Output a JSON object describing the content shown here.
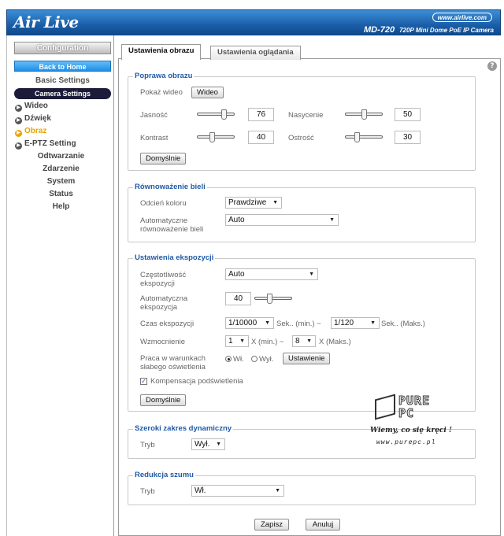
{
  "header": {
    "logo_text": "Air Live",
    "url_badge": "www.airlive.com",
    "model": "MD-720",
    "model_subtitle": "720P Mini Dome PoE IP Camera"
  },
  "sidebar": {
    "configuration": "Configuration",
    "back_home": "Back to Home",
    "basic_settings": "Basic Settings",
    "camera_settings": "Camera Settings",
    "items": [
      {
        "label": "Wideo",
        "active": false
      },
      {
        "label": "Dźwięk",
        "active": false
      },
      {
        "label": "Obraz",
        "active": true
      },
      {
        "label": "E-PTZ Setting",
        "active": false
      }
    ],
    "sub_items": [
      "Odtwarzanie",
      "Zdarzenie",
      "System",
      "Status",
      "Help"
    ]
  },
  "tabs": {
    "image_settings": "Ustawienia obrazu",
    "view_settings": "Ustawienia oglądania"
  },
  "image_improve": {
    "title": "Poprawa obrazu",
    "show_video_label": "Pokaż wideo",
    "video_button": "Wideo",
    "brightness_label": "Jasność",
    "brightness": 76,
    "saturation_label": "Nasycenie",
    "saturation": 50,
    "contrast_label": "Kontrast",
    "contrast": 40,
    "sharpness_label": "Ostrość",
    "sharpness": 30,
    "default_button": "Domyślnie"
  },
  "white_balance": {
    "title": "Równoważenie bieli",
    "color_tone_label": "Odcień koloru",
    "color_tone_value": "Prawdziwe",
    "auto_wb_label_1": "Automatyczne",
    "auto_wb_label_2": "równoważenie bieli",
    "auto_wb_value": "Auto"
  },
  "exposure": {
    "title": "Ustawienia ekspozycji",
    "freq_label_1": "Częstotliwość",
    "freq_label_2": "ekspozycji",
    "freq_value": "Auto",
    "auto_exp_label_1": "Automatyczna",
    "auto_exp_label_2": "ekspozycja",
    "auto_exp_value": 40,
    "time_label": "Czas ekspozycji",
    "time_min": "1/10000",
    "time_min_suffix": "Sek.. (min.) ~",
    "time_max": "1/120",
    "time_max_suffix": "Sek.. (Maks.)",
    "gain_label": "Wzmocnienie",
    "gain_min": "1",
    "gain_min_suffix": "X (min.) ~",
    "gain_max": "8",
    "gain_max_suffix": "X (Maks.)",
    "lowlight_label_1": "Praca w warunkach",
    "lowlight_label_2": "słabego oświetlenia",
    "lowlight_on": "Wł.",
    "lowlight_off": "Wył.",
    "lowlight_button": "Ustawienie",
    "backlight_label": "Kompensacja podświetlenia",
    "backlight_checked": true,
    "default_button": "Domyślnie"
  },
  "wdr": {
    "title": "Szeroki zakres dynamiczny",
    "mode_label": "Tryb",
    "mode_value": "Wył."
  },
  "noise": {
    "title": "Redukcja szumu",
    "mode_label": "Tryb",
    "mode_value": "Wł."
  },
  "actions": {
    "save": "Zapisz",
    "cancel": "Anuluj"
  },
  "watermark": {
    "brand_top": "PURE",
    "brand_bottom": "PC",
    "tagline": "Wiemy, co się kręci !",
    "site": "www.purepc.pl"
  },
  "colors": {
    "header_blue": "#1b5ea8",
    "group_title": "#1f5aa6",
    "active_item": "#e8a400"
  }
}
